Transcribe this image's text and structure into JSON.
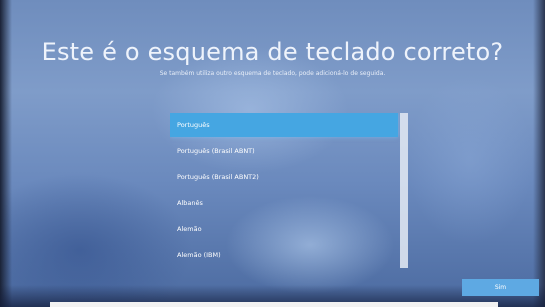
{
  "page": {
    "title": "Este é o esquema de teclado correto?",
    "subtitle": "Se também utiliza outro esquema de teclado, pode adicioná-lo de seguida."
  },
  "layout_list": {
    "items": [
      {
        "label": "Português",
        "selected": true
      },
      {
        "label": "Português (Brasil ABNT)",
        "selected": false
      },
      {
        "label": "Português (Brasil ABNT2)",
        "selected": false
      },
      {
        "label": "Albanês",
        "selected": false
      },
      {
        "label": "Alemão",
        "selected": false
      },
      {
        "label": "Alemão (IBM)",
        "selected": false
      }
    ]
  },
  "buttons": {
    "confirm_label": "Sim"
  },
  "colors": {
    "selection": "#45a6e2",
    "button": "#5ea9e3",
    "text": "#ffffff"
  }
}
